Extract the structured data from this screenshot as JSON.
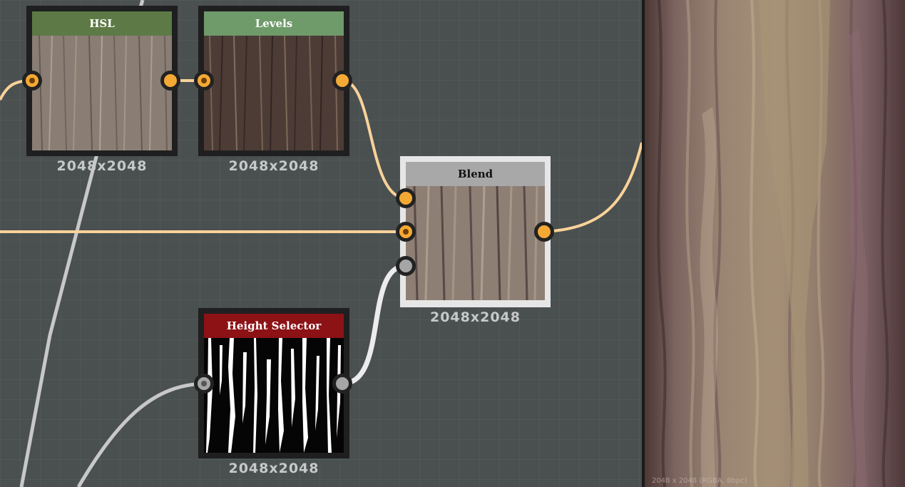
{
  "graph": {
    "nodes": [
      {
        "id": "hsl",
        "title": "HSL",
        "resolution": "2048x2048",
        "header_color": "#5d7a46"
      },
      {
        "id": "levels",
        "title": "Levels",
        "resolution": "2048x2048",
        "header_color": "#6f9a6a"
      },
      {
        "id": "blend",
        "title": "Blend",
        "resolution": "2048x2048",
        "header_color": "#a8a8a8"
      },
      {
        "id": "height_selector",
        "title": "Height Selector",
        "resolution": "2048x2048",
        "header_color": "#8c1216"
      }
    ],
    "port_colors": {
      "color": "#f5a935",
      "grayscale": "#a6a6a6"
    },
    "wire_colors": {
      "color": "#f9d29a",
      "grayscale": "#e8e8e8"
    }
  },
  "preview": {
    "info": "2048 x 2048 (RGBA, 8bpc)"
  }
}
